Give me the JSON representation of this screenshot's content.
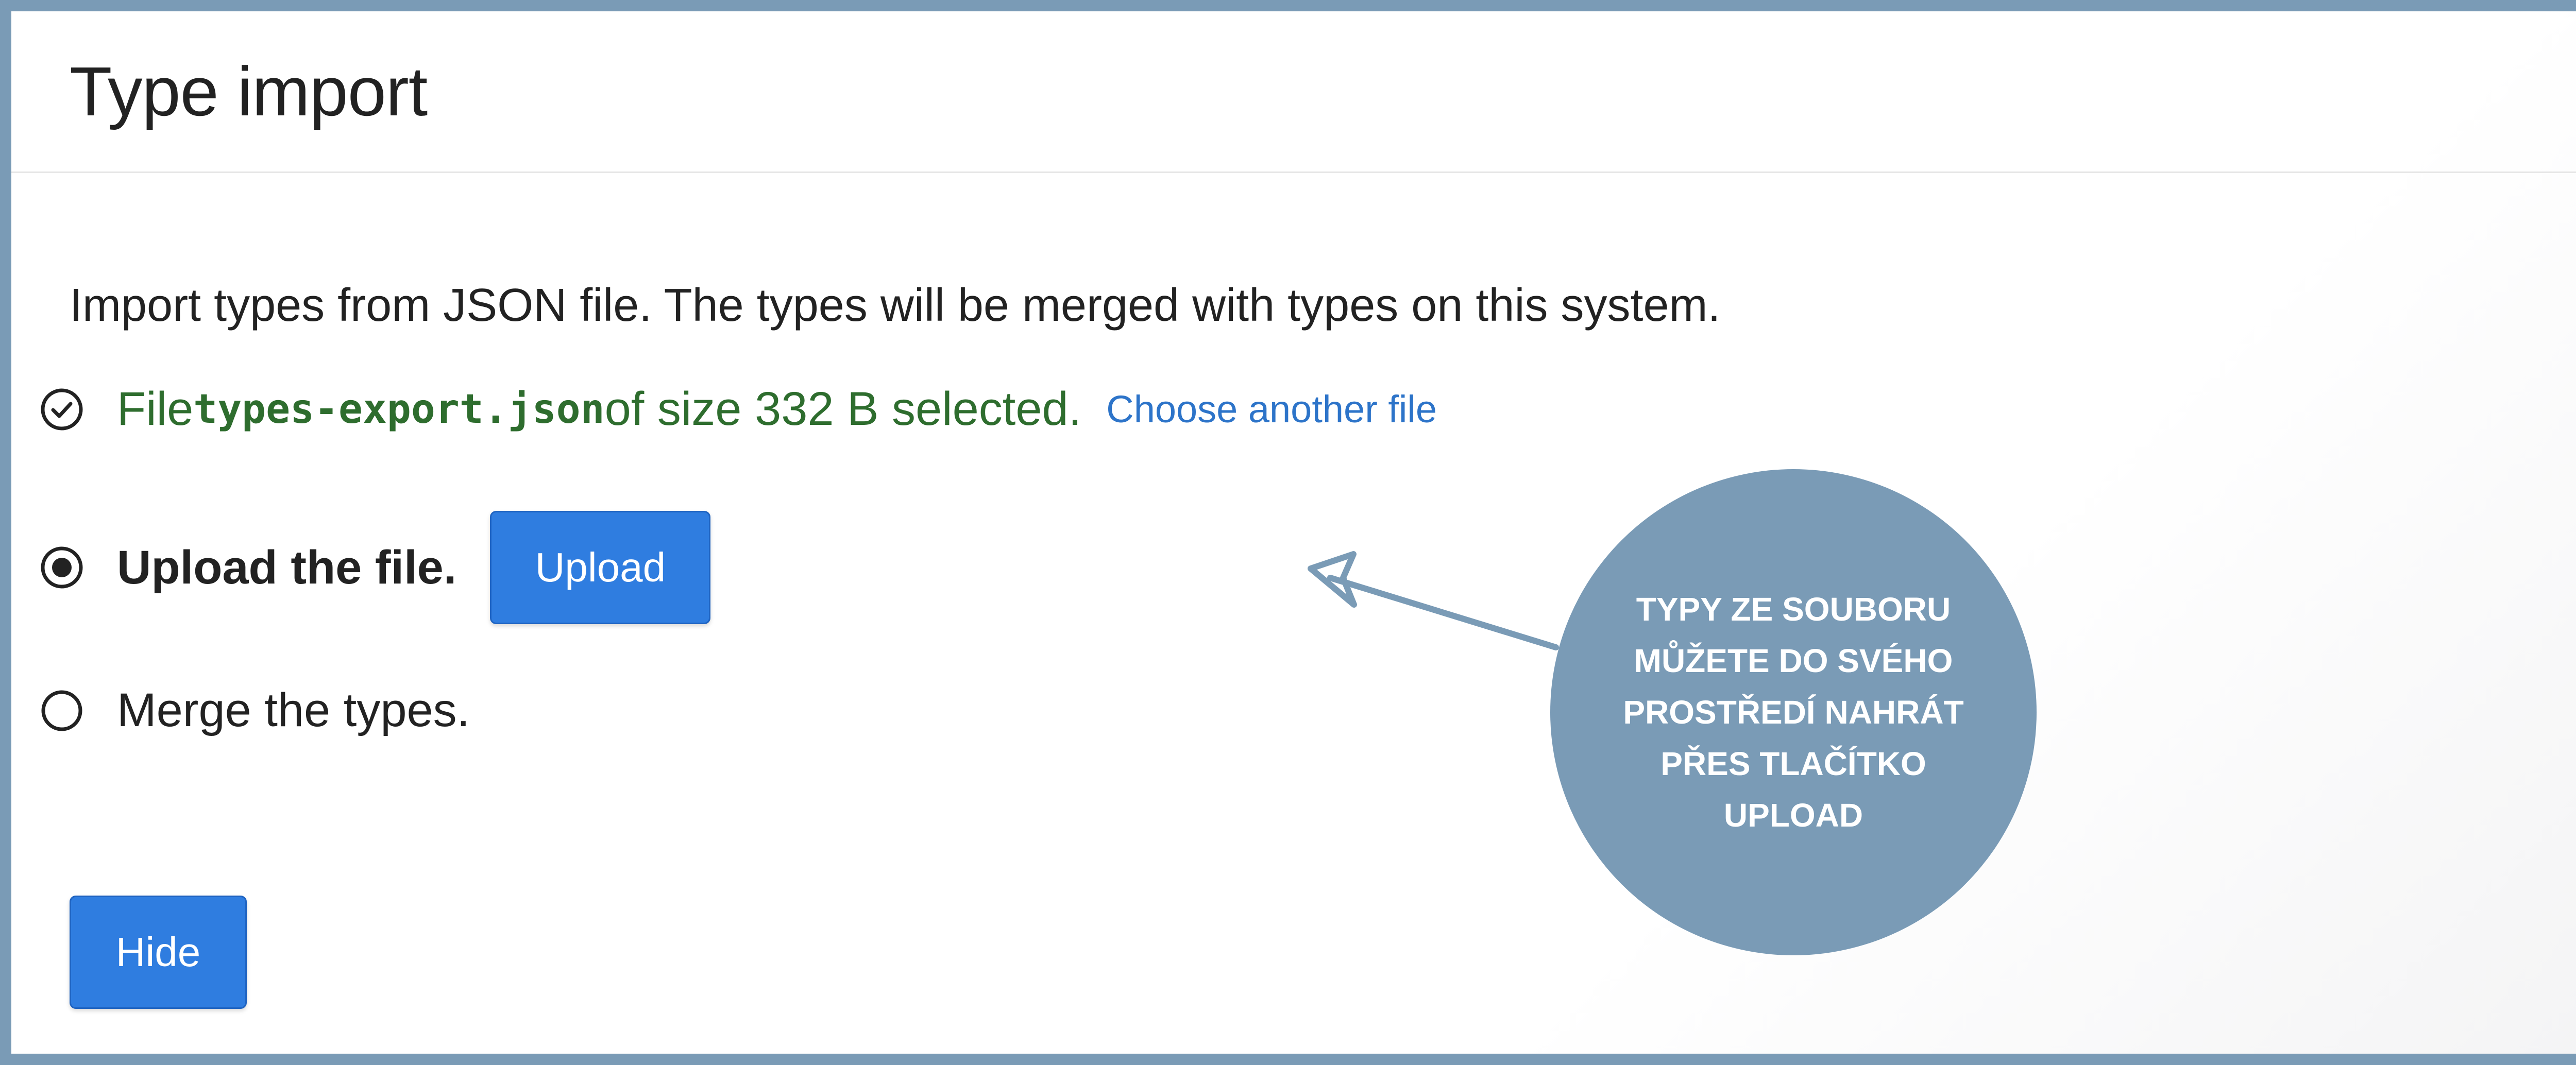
{
  "dialog": {
    "title": "Type import",
    "intro": "Import types from JSON file. The types will be merged with types on this system."
  },
  "steps": {
    "file": {
      "prefix": "File ",
      "filename": "types-export.json",
      "suffix": " of size 332 B selected.",
      "link": "Choose another file",
      "status": "done"
    },
    "upload": {
      "label": "Upload the file.",
      "button": "Upload",
      "status": "current"
    },
    "merge": {
      "label": "Merge the types.",
      "status": "pending"
    }
  },
  "actions": {
    "hide": "Hide"
  },
  "callout": {
    "text": "TYPY ZE SOUBORU MŮŽETE DO SVÉHO PROSTŘEDÍ NAHRÁT PŘES TLAČÍTKO UPLOAD"
  },
  "colors": {
    "frame": "#7a9bb6",
    "primary": "#2f7de0",
    "success": "#2e6d2e",
    "link": "#2d74c9"
  }
}
